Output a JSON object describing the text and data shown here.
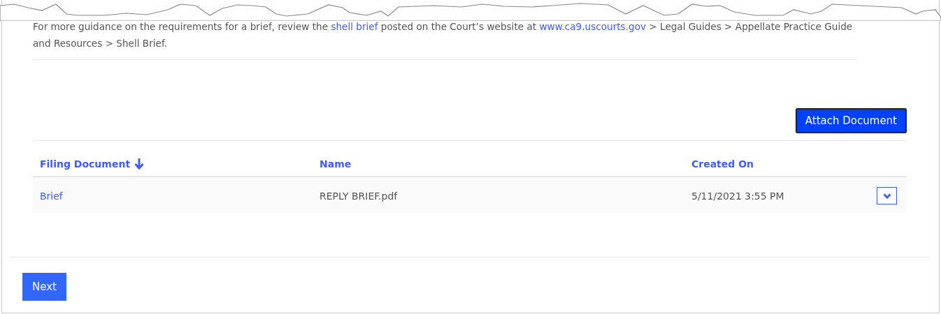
{
  "guidance": [
    {
      "kind": "text",
      "text": "For more guidance on the requirements for a brief, review the "
    },
    {
      "kind": "link",
      "text": "shell brief"
    },
    {
      "kind": "text",
      "text": " posted on the Court’s website at "
    },
    {
      "kind": "link",
      "text": "www.ca9.uscourts.gov"
    },
    {
      "kind": "text",
      "text": " > Legal Guides > Appellate Practice Guide and Resources > Shell Brief."
    }
  ],
  "attach_button": {
    "label": "Attach Document",
    "focused": true
  },
  "table": {
    "columns": [
      {
        "label": "Filing Document",
        "sorted": true
      },
      {
        "label": "Name",
        "sorted": false
      },
      {
        "label": "Created On",
        "sorted": false
      }
    ],
    "rows": [
      {
        "filing_document": "Brief",
        "name": "REPLY BRIEF.pdf",
        "created_on": "5/11/2021 3:55 PM"
      }
    ]
  },
  "next_button": {
    "label": "Next"
  }
}
